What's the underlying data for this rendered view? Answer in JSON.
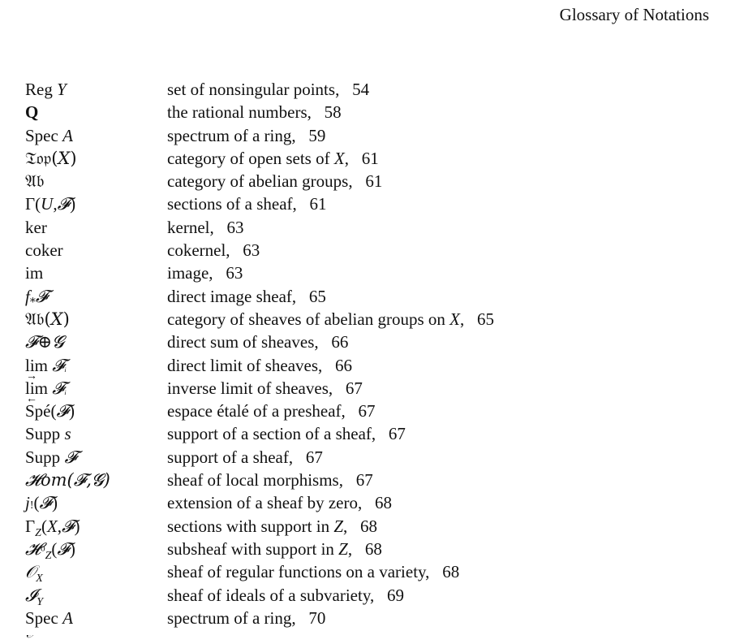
{
  "page": {
    "header": "Glossary of Notations"
  },
  "entries": [
    {
      "symbol": "Reg Y",
      "description": "set of nonsingular points,",
      "page": "54"
    },
    {
      "symbol": "Q",
      "description": "the rational numbers,",
      "page": "58"
    },
    {
      "symbol": "Spec A",
      "description": "spectrum of a ring,",
      "page": "59"
    },
    {
      "symbol": "𝔗𝔬𝔭(X)",
      "description": "category of open sets of X,",
      "page": "61"
    },
    {
      "symbol": "𝔄𝔟",
      "description": "category of abelian groups,",
      "page": "61"
    },
    {
      "symbol": "Γ(U,𝓕)",
      "description": "sections of a sheaf,",
      "page": "61"
    },
    {
      "symbol": "ker",
      "description": "kernel,",
      "page": "63"
    },
    {
      "symbol": "coker",
      "description": "cokernel,",
      "page": "63"
    },
    {
      "symbol": "im",
      "description": "image,",
      "page": "63"
    },
    {
      "symbol": "f₊𝓕",
      "description": "direct image sheaf,",
      "page": "65"
    },
    {
      "symbol": "𝔄𝔟(X)",
      "description": "category of sheaves of abelian groups on X,",
      "page": "65"
    },
    {
      "symbol": "𝓕⊕𝓖",
      "description": "direct sum of sheaves,",
      "page": "66"
    },
    {
      "symbol": "lim 𝓕ᵢ (→)",
      "description": "direct limit of sheaves,",
      "page": "66"
    },
    {
      "symbol": "lim 𝓕ᵢ (←)",
      "description": "inverse limit of sheaves,",
      "page": "67"
    },
    {
      "symbol": "Spé(𝓕)",
      "description": "espace étalé of a presheaf,",
      "page": "67"
    },
    {
      "symbol": "Supp s",
      "description": "support of a section of a sheaf,",
      "page": "67"
    },
    {
      "symbol": "Supp 𝓕",
      "description": "support of a sheaf,",
      "page": "67"
    },
    {
      "symbol": "𝓗om(𝓕,𝓖)",
      "description": "sheaf of local morphisms,",
      "page": "67"
    },
    {
      "symbol": "j!(𝓕)",
      "description": "extension of a sheaf by zero,",
      "page": "68"
    },
    {
      "symbol": "Γ_Z(X,𝓕)",
      "description": "sections with support in Z,",
      "page": "68"
    },
    {
      "symbol": "𝓗⁰_Z(𝓕)",
      "description": "subsheaf with support in Z,",
      "page": "68"
    },
    {
      "symbol": "𝒪_X",
      "description": "sheaf of regular functions on a variety,",
      "page": "68"
    },
    {
      "symbol": "𝓘_Y",
      "description": "sheaf of ideals of a subvariety,",
      "page": "69"
    },
    {
      "symbol": "Spec A",
      "description": "spectrum of a ring,",
      "page": "70"
    }
  ]
}
